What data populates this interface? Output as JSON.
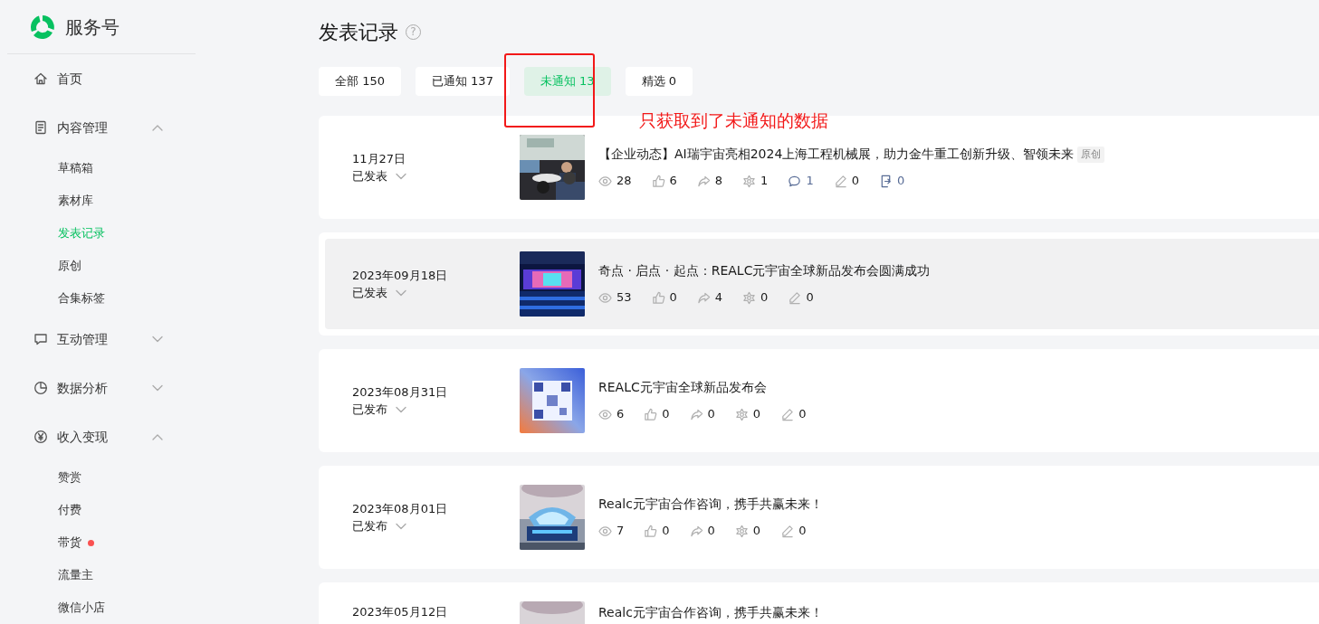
{
  "sidebar": {
    "brand": "服务号",
    "items": [
      {
        "kind": "link",
        "label": "首页",
        "selected": false
      },
      {
        "kind": "group",
        "label": "内容管理",
        "expanded": true,
        "children": [
          {
            "label": "草稿箱",
            "selected": false,
            "dot": false
          },
          {
            "label": "素材库",
            "selected": false,
            "dot": false
          },
          {
            "label": "发表记录",
            "selected": true,
            "dot": false
          },
          {
            "label": "原创",
            "selected": false,
            "dot": false
          },
          {
            "label": "合集标签",
            "selected": false,
            "dot": false
          }
        ]
      },
      {
        "kind": "group",
        "label": "互动管理",
        "expanded": false
      },
      {
        "kind": "group",
        "label": "数据分析",
        "expanded": false
      },
      {
        "kind": "group",
        "label": "收入变现",
        "expanded": true,
        "children": [
          {
            "label": "赞赏",
            "selected": false,
            "dot": false
          },
          {
            "label": "付费",
            "selected": false,
            "dot": false
          },
          {
            "label": "带货",
            "selected": false,
            "dot": true
          },
          {
            "label": "流量主",
            "selected": false,
            "dot": false
          },
          {
            "label": "微信小店",
            "selected": false,
            "dot": false
          }
        ]
      }
    ]
  },
  "page": {
    "title": "发表记录",
    "help": "?"
  },
  "tabs": [
    {
      "label": "全部 150",
      "selected": false
    },
    {
      "label": "已通知 137",
      "selected": false
    },
    {
      "label": "未通知 13",
      "selected": true
    },
    {
      "label": "精选 0",
      "selected": false
    }
  ],
  "annotation": {
    "text": "只获取到了未通知的数据"
  },
  "posts": [
    {
      "date": "11月27日",
      "status": "已发表",
      "title": "【企业动态】AI瑞宇宙亮相2024上海工程机械展，助力金牛重工创新升级、智领未来",
      "tag": "原创",
      "hovered": false,
      "stats": [
        {
          "kind": "views",
          "value": "28"
        },
        {
          "kind": "likes",
          "value": "6"
        },
        {
          "kind": "shares",
          "value": "8"
        },
        {
          "kind": "wow",
          "value": "1"
        },
        {
          "kind": "comments",
          "value": "1"
        },
        {
          "kind": "notes",
          "value": "0"
        },
        {
          "kind": "forwards",
          "value": "0"
        }
      ]
    },
    {
      "date": "2023年09月18日",
      "status": "已发表",
      "title": "奇点 · 启点 · 起点：REALC元宇宙全球新品发布会圆满成功",
      "hovered": true,
      "stats": [
        {
          "kind": "views",
          "value": "53"
        },
        {
          "kind": "likes",
          "value": "0"
        },
        {
          "kind": "shares",
          "value": "4"
        },
        {
          "kind": "wow",
          "value": "0"
        },
        {
          "kind": "notes",
          "value": "0"
        }
      ]
    },
    {
      "date": "2023年08月31日",
      "status": "已发布",
      "title": "REALC元宇宙全球新品发布会",
      "hovered": false,
      "stats": [
        {
          "kind": "views",
          "value": "6"
        },
        {
          "kind": "likes",
          "value": "0"
        },
        {
          "kind": "shares",
          "value": "0"
        },
        {
          "kind": "wow",
          "value": "0"
        },
        {
          "kind": "notes",
          "value": "0"
        }
      ]
    },
    {
      "date": "2023年08月01日",
      "status": "已发布",
      "title": "Realc元宇宙合作咨询，携手共赢未来！",
      "hovered": false,
      "stats": [
        {
          "kind": "views",
          "value": "7"
        },
        {
          "kind": "likes",
          "value": "0"
        },
        {
          "kind": "shares",
          "value": "0"
        },
        {
          "kind": "wow",
          "value": "0"
        },
        {
          "kind": "notes",
          "value": "0"
        }
      ]
    },
    {
      "date": "2023年05月12日",
      "title": "Realc元宇宙合作咨询，携手共赢未来！",
      "hovered": false
    }
  ]
}
